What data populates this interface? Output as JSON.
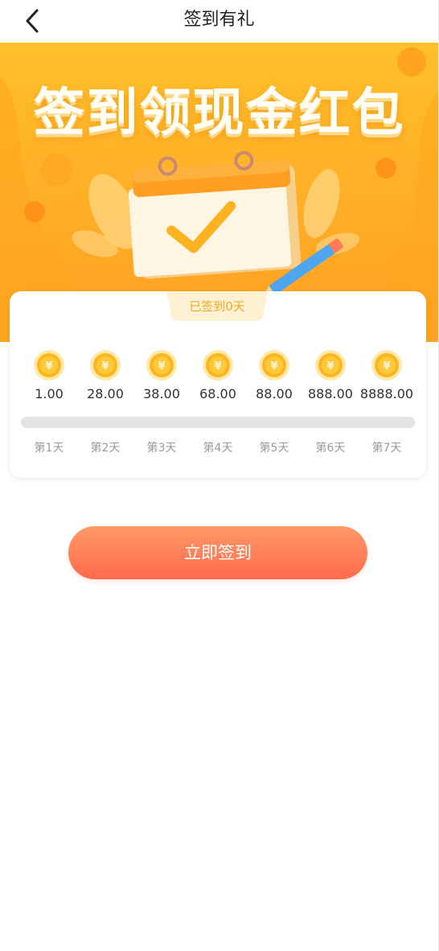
{
  "header": {
    "title": "签到有礼",
    "back_icon": "chevron-left-icon"
  },
  "banner": {
    "title": "签到领现金红包"
  },
  "checkin": {
    "status_text": "已签到0天",
    "signed_days": 0,
    "progress": 0,
    "days": [
      {
        "amount": "1.00",
        "label": "第1天"
      },
      {
        "amount": "28.00",
        "label": "第2天"
      },
      {
        "amount": "38.00",
        "label": "第3天"
      },
      {
        "amount": "68.00",
        "label": "第4天"
      },
      {
        "amount": "88.00",
        "label": "第5天"
      },
      {
        "amount": "888.00",
        "label": "第6天"
      },
      {
        "amount": "8888.00",
        "label": "第7天"
      }
    ],
    "coin_icon": "yuan-coin-icon"
  },
  "actions": {
    "sign_button_label": "立即签到"
  },
  "colors": {
    "banner": "#ffb127",
    "button": "#ff7a55",
    "tab_text": "#f5a623"
  }
}
